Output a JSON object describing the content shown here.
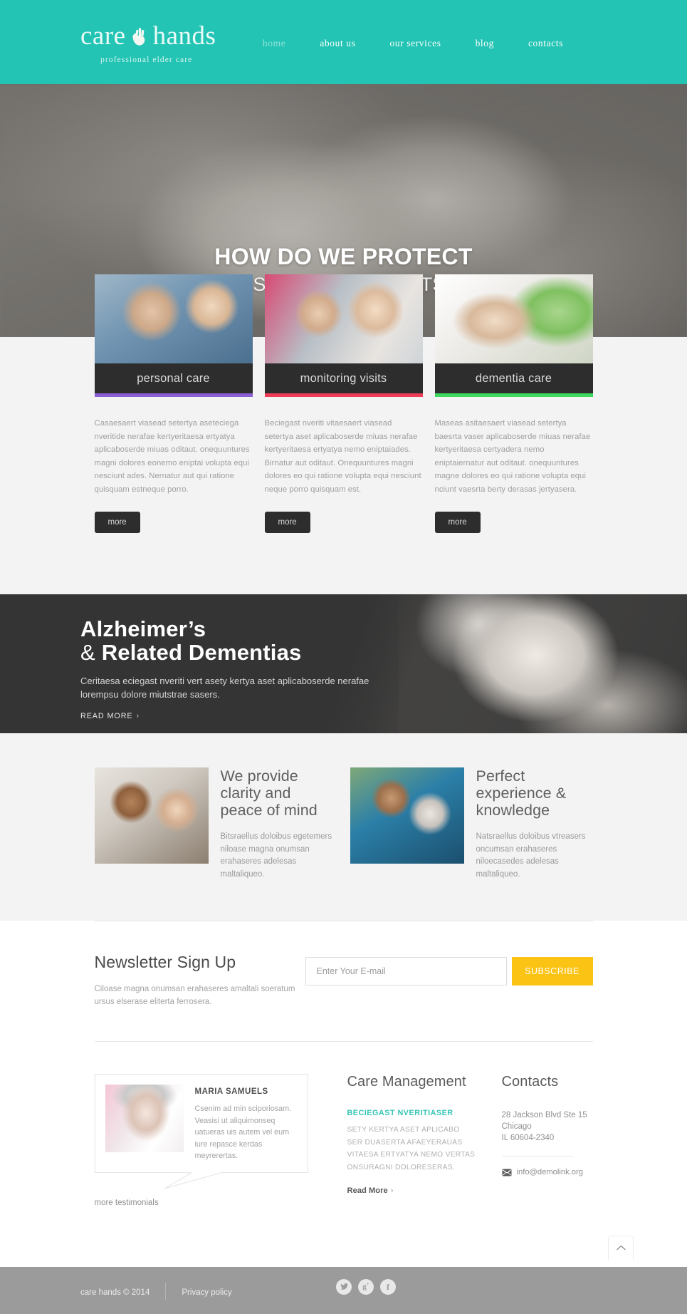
{
  "header": {
    "logo_word1": "care",
    "logo_word2": "hands",
    "logo_icon": "hand-icon",
    "tagline": "professional elder care",
    "brand_color": "#24c4b4",
    "nav": [
      {
        "label": "home",
        "active": true
      },
      {
        "label": "about us",
        "active": false
      },
      {
        "label": "our services",
        "active": false
      },
      {
        "label": "blog",
        "active": false
      },
      {
        "label": "contacts",
        "active": false
      }
    ]
  },
  "hero": {
    "title": "HOW DO WE PROTECT",
    "subtitle": "OUR ELDERS FROM ACCIDENTS AT HOME?"
  },
  "services": [
    {
      "title": "personal care",
      "rule_color": "#8a5fd6",
      "body": "Casaesaert viasead setertya aseteciega nveritide nerafae kertyeritaesa ertyatya aplicaboserde miuas  oditaut. onequuntures magni dolores eonemo eniptai volupta equi nesciunt ades. Nernatur aut qui ratione quisquam estneque porro.",
      "button": "more"
    },
    {
      "title": "monitoring visits",
      "rule_color": "#ef3d58",
      "body": "Beciegast nveriti vitaesaert viasead setertya aset aplicaboserde miuas nerafae kertyeritaesa ertyatya nemo eniptaiades. Birnatur aut oditaut. Onequuntures magni dolores eo qui ratione volupta equi nesciunt neque porro quisquam est.",
      "button": "more"
    },
    {
      "title": "dementia care",
      "rule_color": "#3ed75f",
      "body": "Maseas asitaesaert viasead setertya baesrta vaser aplicaboserde miuas nerafae kertyeritaesa  certyadera nemo eniptaiernatur aut oditaut. onequuntures magne dolores eo qui ratione volupta equi nciunt vaesrta berty derasas jertyasera.",
      "button": "more"
    }
  ],
  "alzheimer": {
    "title_line1": "Alzheimer’s",
    "title_amp": "&",
    "title_line2": "Related Dementias",
    "body": "Ceritaesa eciegast nveriti vert asety kertya aset aplicaboserde nerafae lorempsu dolore miutstrae sasers.",
    "link": "READ MORE",
    "link_chevron": "›"
  },
  "features": [
    {
      "heading": "We provide clarity and peace of mind",
      "body": "Bitsraellus doloibus egetemers niloase magna onumsan erahaseres adelesas maltaliqueo."
    },
    {
      "heading": "Perfect experience & knowledge",
      "body": "Natsraellus doloibus vtreasers oncumsan erahaseres niloecasedes adelesas maltaliqueo."
    }
  ],
  "newsletter": {
    "heading": "Newsletter Sign Up",
    "body": "Ciloase magna onumsan erahaseres amaltali soeratum ursus elserase eliterta ferrosera.",
    "input_value": "",
    "input_placeholder": "Enter Your E-mail",
    "button": "SUBSCRIBE",
    "button_color": "#fbc313"
  },
  "testimonial": {
    "name": "MARIA SAMUELS",
    "body": "Csenim ad min sciporiosam. Veasisi ut aliquimonseq uatueras uis autem vel eum iure repasce kerdas meyrerertas.",
    "more_link": "more testimonials"
  },
  "care_management": {
    "heading": "Care Management",
    "subheading": "BECIEGAST NVERITIASER",
    "subheading_color": "#35c4b5",
    "body": "SETY KERTYA ASET APLICABO SER DUASERTA AFAEYERAUAS VITAESA ERTYATYA NEMO VERTAS ONSURAGNI DOLORESERAS.",
    "read_more": "Read More",
    "read_more_chevron": "›"
  },
  "contacts": {
    "heading": "Contacts",
    "address_line1": "28 Jackson Blvd Ste 15",
    "address_line2": "Chicago",
    "address_line3": "IL 60604-2340",
    "email": "info@demolink.org",
    "email_icon": "envelope-icon"
  },
  "footer": {
    "copyright": "care hands © 2014",
    "privacy": "Privacy policy",
    "socials": [
      {
        "name": "twitter-icon",
        "glyph": "✐"
      },
      {
        "name": "google-plus-icon",
        "glyph": "g⁺"
      },
      {
        "name": "facebook-icon",
        "glyph": "f"
      }
    ],
    "scroll_top_icon": "chevron-up-icon"
  }
}
